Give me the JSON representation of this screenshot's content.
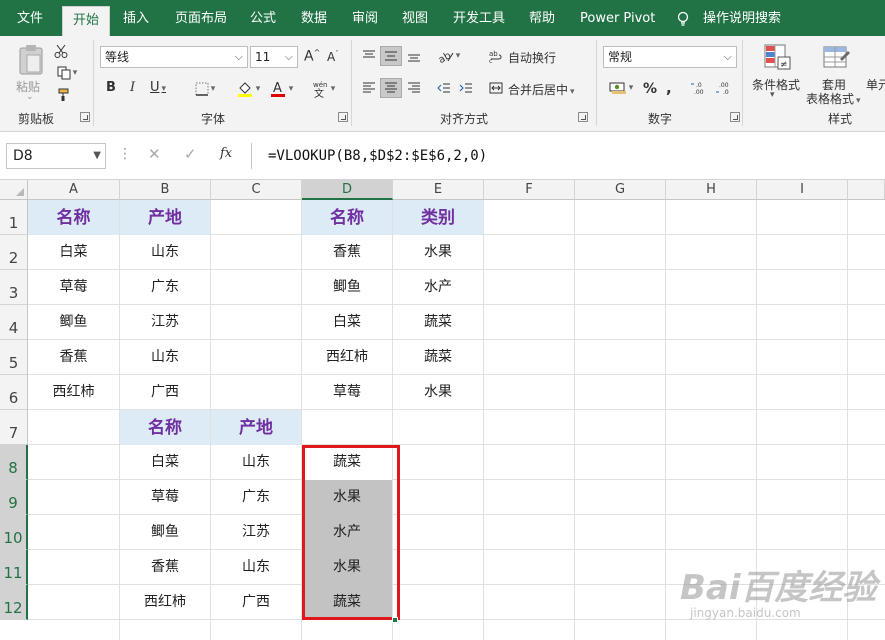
{
  "menu": {
    "tabs": [
      "文件",
      "开始",
      "插入",
      "页面布局",
      "公式",
      "数据",
      "审阅",
      "视图",
      "开发工具",
      "帮助",
      "Power Pivot"
    ],
    "search": "操作说明搜索"
  },
  "ribbon": {
    "clipboard": {
      "label": "剪贴板",
      "paste": "粘贴"
    },
    "font": {
      "label": "字体",
      "name": "等线",
      "size": "11"
    },
    "alignment": {
      "label": "对齐方式",
      "wrap": "自动换行",
      "merge": "合并后居中"
    },
    "number": {
      "label": "数字",
      "format": "常规",
      "percent": "%"
    },
    "styles": {
      "label": "样式",
      "conditional": "条件格式",
      "table_format_1": "套用",
      "table_format_2": "表格格式",
      "cell_styles": "单元"
    }
  },
  "formula_bar": {
    "name_box": "D8",
    "fx": "fx",
    "formula": "=VLOOKUP(B8,$D$2:$E$6,2,0)"
  },
  "sheet": {
    "columns": [
      "A",
      "B",
      "C",
      "D",
      "E",
      "F",
      "G",
      "H",
      "I"
    ],
    "rows": [
      "1",
      "2",
      "3",
      "4",
      "5",
      "6",
      "7",
      "8",
      "9",
      "10",
      "11",
      "12"
    ],
    "a_col": [
      "名称",
      "白菜",
      "草莓",
      "鲫鱼",
      "香蕉",
      "西红柿"
    ],
    "b_col": [
      "产地",
      "山东",
      "广东",
      "江苏",
      "山东",
      "广西"
    ],
    "d_col": [
      "名称",
      "香蕉",
      "鲫鱼",
      "白菜",
      "西红柿",
      "草莓"
    ],
    "e_col": [
      "类别",
      "水果",
      "水产",
      "蔬菜",
      "蔬菜",
      "水果"
    ],
    "table2_headers": [
      "名称",
      "产地"
    ],
    "table2_names": [
      "白菜",
      "草莓",
      "鲫鱼",
      "香蕉",
      "西红柿"
    ],
    "table2_origins": [
      "山东",
      "广东",
      "江苏",
      "山东",
      "广西"
    ],
    "results": [
      "蔬菜",
      "水果",
      "水产",
      "水果",
      "蔬菜"
    ]
  },
  "watermark": {
    "text": "Bai百度经验",
    "sub": "jingyan.baidu.com"
  }
}
